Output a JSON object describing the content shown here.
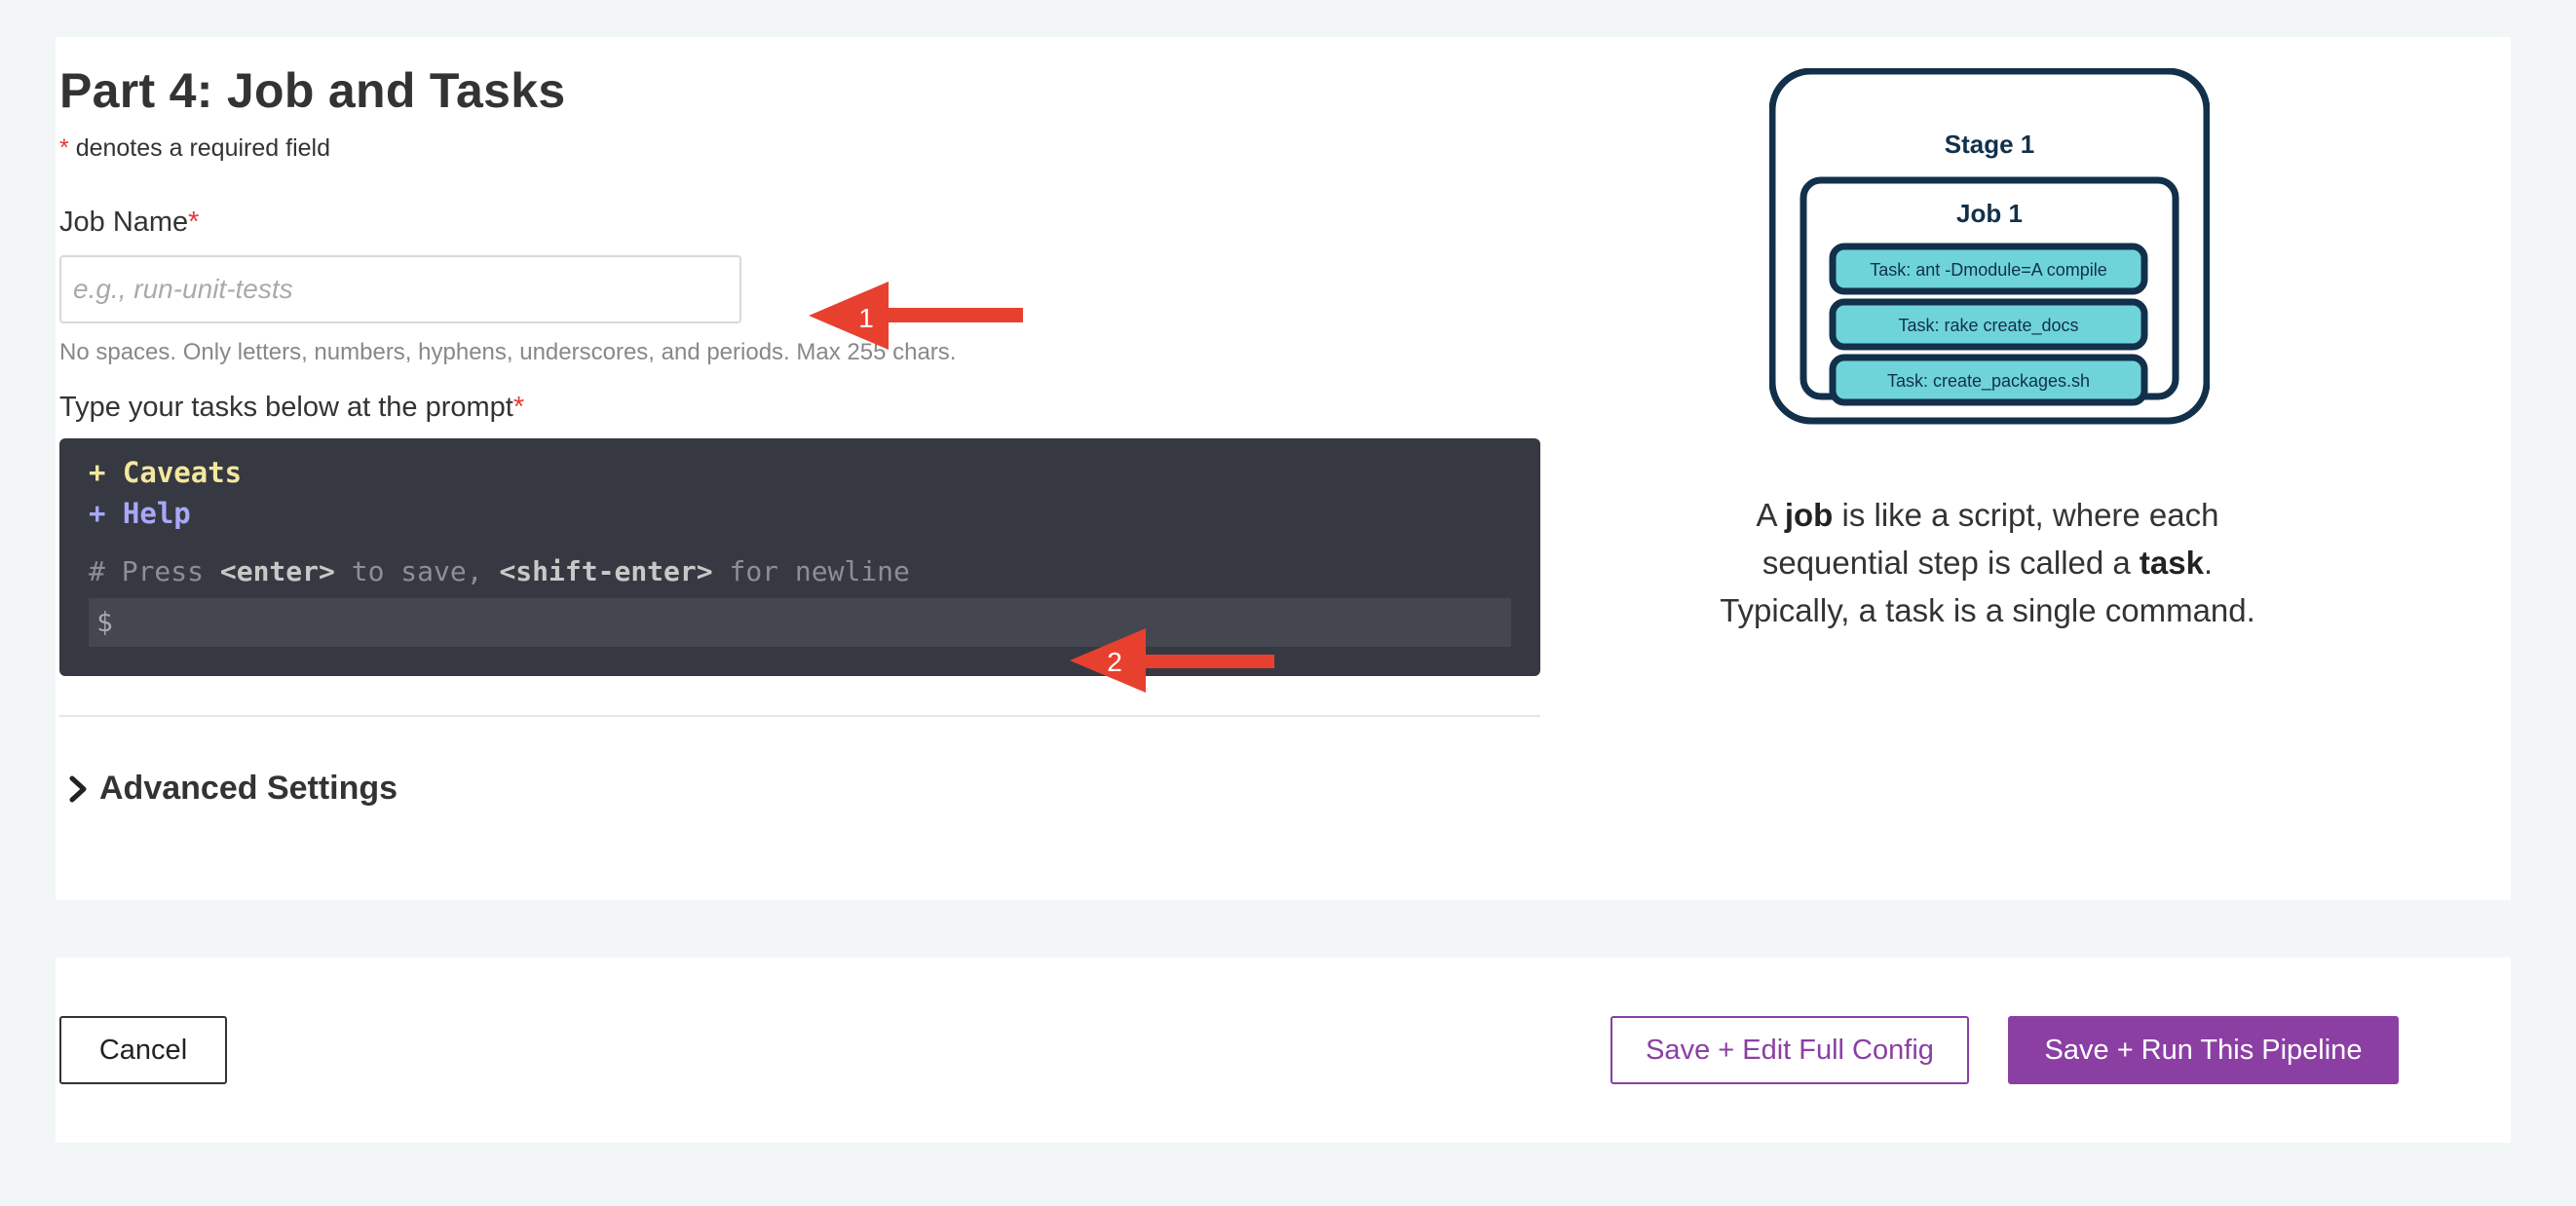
{
  "page": {
    "title": "Part 4: Job and Tasks",
    "required_asterisk": "*",
    "required_note": "denotes a required field"
  },
  "job_name": {
    "label": "Job Name",
    "placeholder": "e.g., run-unit-tests",
    "value": "",
    "hint": "No spaces. Only letters, numbers, hyphens, underscores, and periods. Max 255 chars."
  },
  "tasks": {
    "label": "Type your tasks below at the prompt",
    "terminal": {
      "caveats": "+ Caveats",
      "help": "+ Help",
      "comment_prefix": "# Press ",
      "enter_key": "<enter>",
      "comment_mid": " to save, ",
      "shift_enter_key": "<shift-enter>",
      "comment_suffix": " for newline",
      "prompt": "$"
    }
  },
  "advanced": {
    "label": "Advanced Settings",
    "icon": "chevron-right-icon"
  },
  "illustration": {
    "stage": "Stage 1",
    "job": "Job 1",
    "tasks": [
      "Task: ant -Dmodule=A compile",
      "Task: rake create_docs",
      "Task: create_packages.sh"
    ]
  },
  "explanation": {
    "p1": "A ",
    "job_word": "job",
    "p2": " is like a script, where each sequential step is called a ",
    "task_word": "task",
    "p3": ". Typically, a task is a single command."
  },
  "annotations": {
    "arrow1": "1",
    "arrow2": "2"
  },
  "footer": {
    "cancel": "Cancel",
    "save_edit": "Save + Edit Full Config",
    "save_run": "Save + Run This Pipeline"
  },
  "colors": {
    "accent": "#8b3fa3",
    "required": "#e53935",
    "terminal_bg": "#363941",
    "task_fill": "#6fd4d9",
    "diagram_stroke": "#12304a",
    "arrow": "#e8402f"
  }
}
